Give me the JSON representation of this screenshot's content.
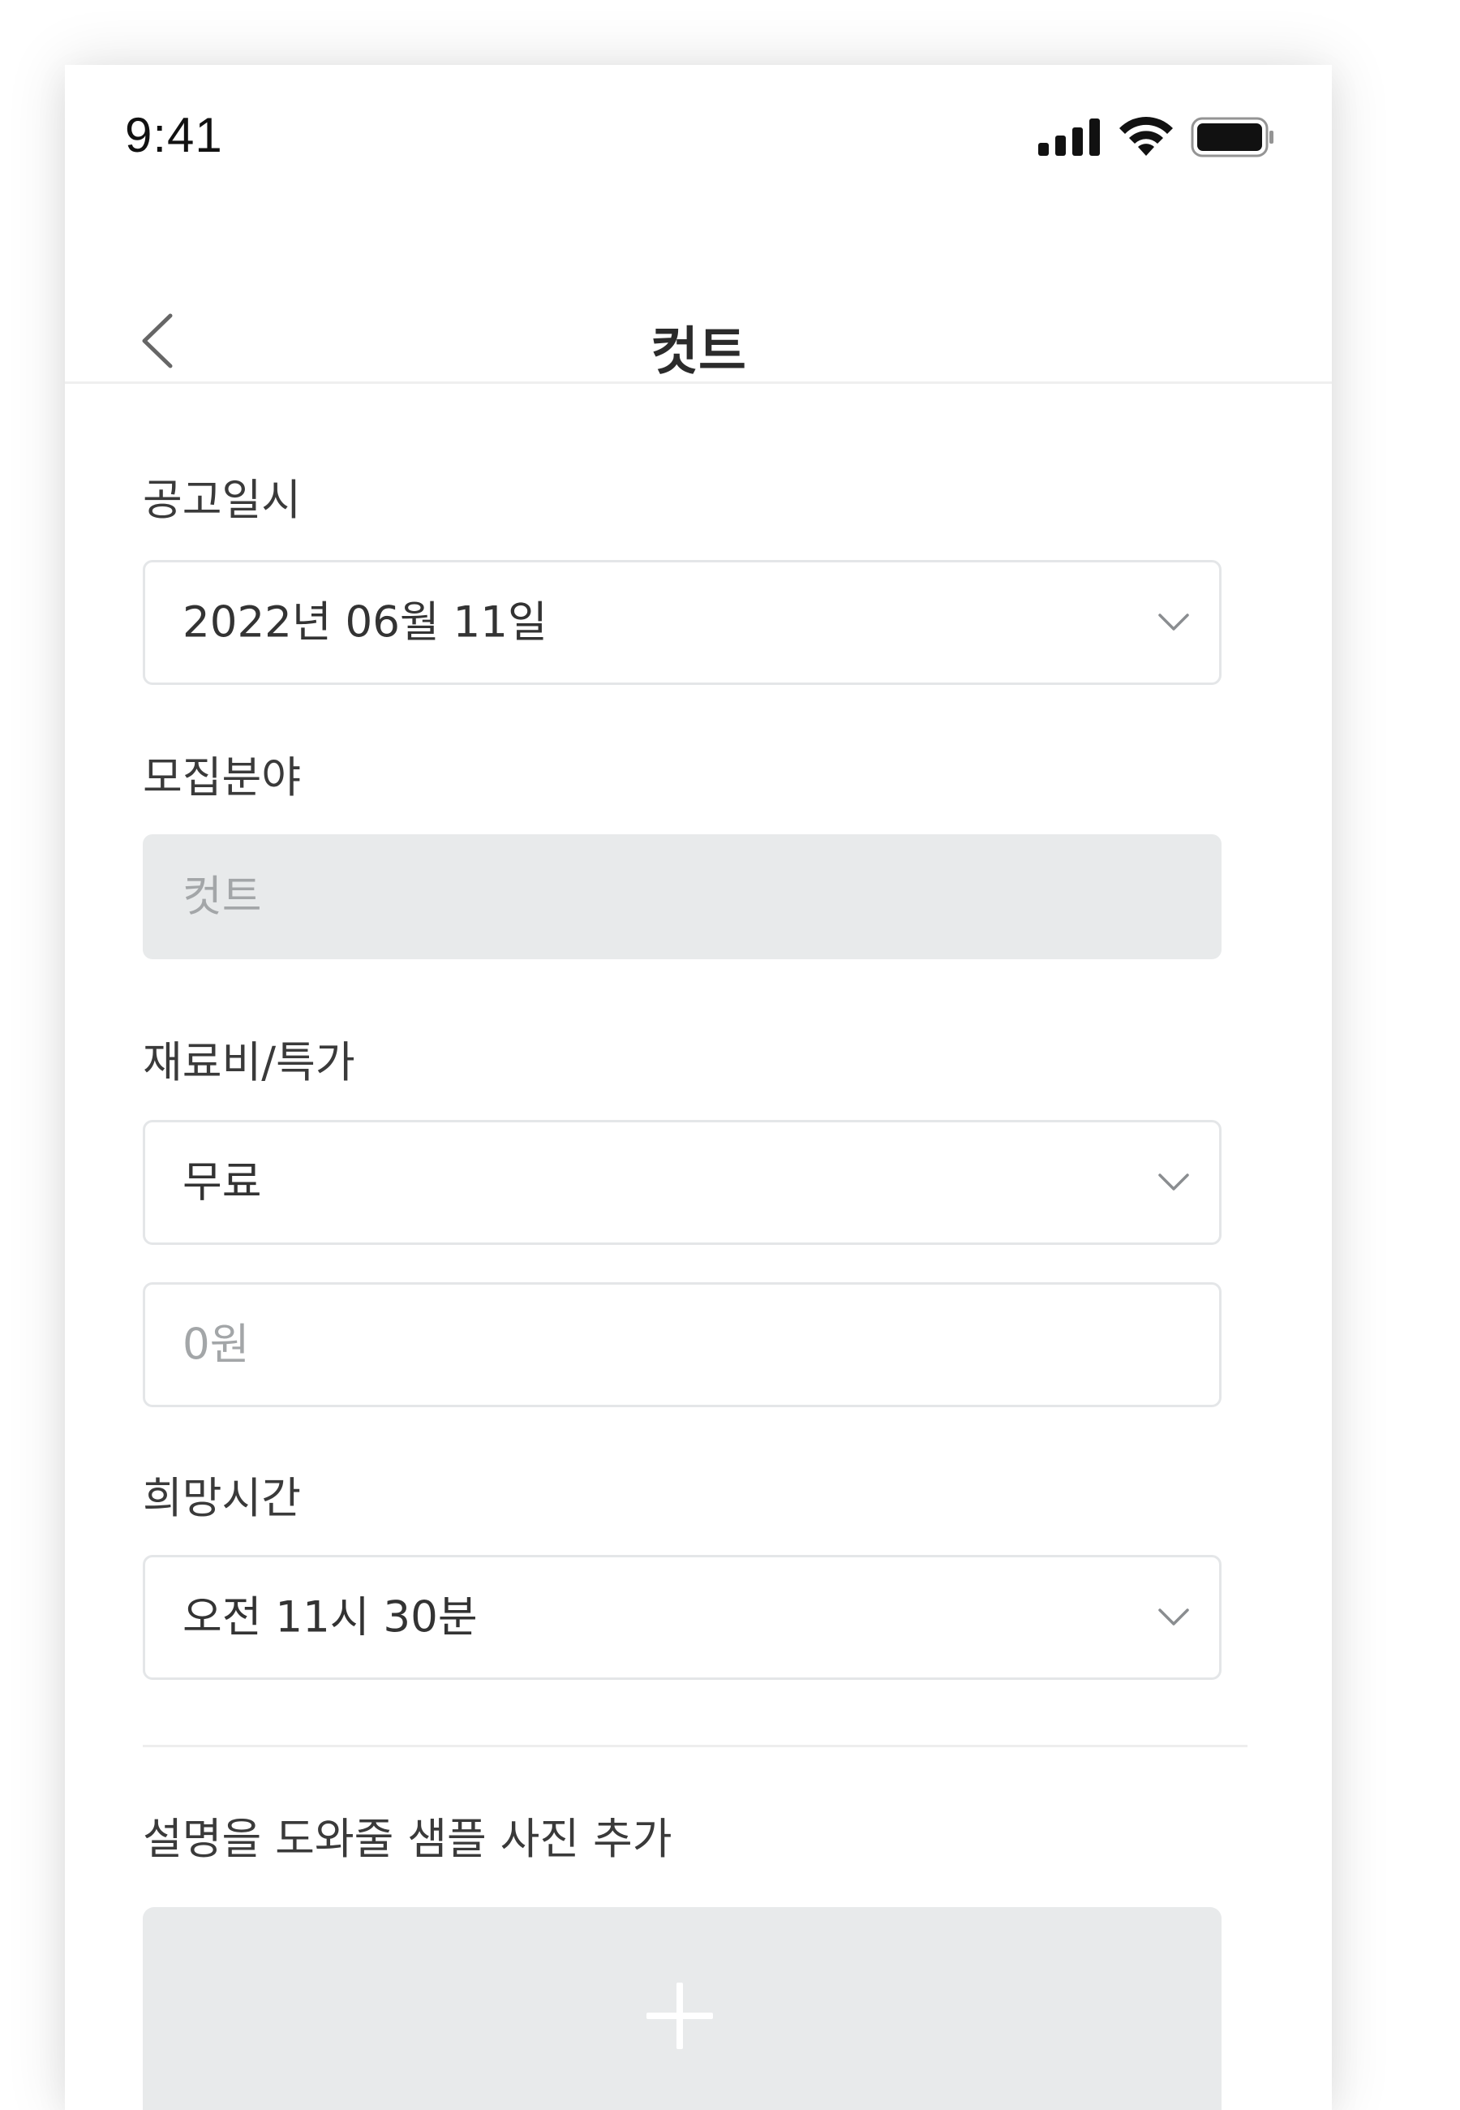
{
  "status_bar": {
    "time": "9:41",
    "icons": [
      "signal-icon",
      "wifi-icon",
      "battery-icon"
    ]
  },
  "header": {
    "title": "컷트",
    "back_icon": "chevron-left-icon"
  },
  "form": {
    "announce_date": {
      "label": "공고일시",
      "value": "2022년 06월 11일"
    },
    "recruit_field": {
      "label": "모집분야",
      "value": "컷트"
    },
    "material_cost": {
      "label": "재료비/특가",
      "value": "무료",
      "amount_placeholder": "0원"
    },
    "preferred_time": {
      "label": "희망시간",
      "value": "오전 11시 30분"
    },
    "sample_photo": {
      "label": "설명을 도와줄 샘플 사진 추가",
      "add_icon": "plus-icon"
    }
  },
  "colors": {
    "text": "#2b2b2b",
    "border": "#e4e6e8",
    "disabled_bg": "#e8eaeb",
    "placeholder": "#a3a6a8"
  }
}
